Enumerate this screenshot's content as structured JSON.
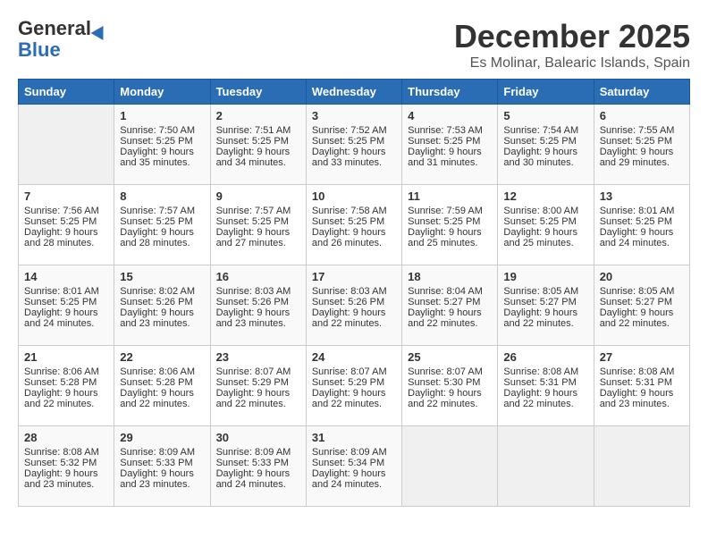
{
  "logo": {
    "general": "General",
    "blue": "Blue"
  },
  "title": {
    "month": "December 2025",
    "location": "Es Molinar, Balearic Islands, Spain"
  },
  "days_header": [
    "Sunday",
    "Monday",
    "Tuesday",
    "Wednesday",
    "Thursday",
    "Friday",
    "Saturday"
  ],
  "weeks": [
    [
      {
        "day": "",
        "info": ""
      },
      {
        "day": "1",
        "sunrise": "Sunrise: 7:50 AM",
        "sunset": "Sunset: 5:25 PM",
        "daylight": "Daylight: 9 hours and 35 minutes."
      },
      {
        "day": "2",
        "sunrise": "Sunrise: 7:51 AM",
        "sunset": "Sunset: 5:25 PM",
        "daylight": "Daylight: 9 hours and 34 minutes."
      },
      {
        "day": "3",
        "sunrise": "Sunrise: 7:52 AM",
        "sunset": "Sunset: 5:25 PM",
        "daylight": "Daylight: 9 hours and 33 minutes."
      },
      {
        "day": "4",
        "sunrise": "Sunrise: 7:53 AM",
        "sunset": "Sunset: 5:25 PM",
        "daylight": "Daylight: 9 hours and 31 minutes."
      },
      {
        "day": "5",
        "sunrise": "Sunrise: 7:54 AM",
        "sunset": "Sunset: 5:25 PM",
        "daylight": "Daylight: 9 hours and 30 minutes."
      },
      {
        "day": "6",
        "sunrise": "Sunrise: 7:55 AM",
        "sunset": "Sunset: 5:25 PM",
        "daylight": "Daylight: 9 hours and 29 minutes."
      }
    ],
    [
      {
        "day": "7",
        "sunrise": "Sunrise: 7:56 AM",
        "sunset": "Sunset: 5:25 PM",
        "daylight": "Daylight: 9 hours and 28 minutes."
      },
      {
        "day": "8",
        "sunrise": "Sunrise: 7:57 AM",
        "sunset": "Sunset: 5:25 PM",
        "daylight": "Daylight: 9 hours and 28 minutes."
      },
      {
        "day": "9",
        "sunrise": "Sunrise: 7:57 AM",
        "sunset": "Sunset: 5:25 PM",
        "daylight": "Daylight: 9 hours and 27 minutes."
      },
      {
        "day": "10",
        "sunrise": "Sunrise: 7:58 AM",
        "sunset": "Sunset: 5:25 PM",
        "daylight": "Daylight: 9 hours and 26 minutes."
      },
      {
        "day": "11",
        "sunrise": "Sunrise: 7:59 AM",
        "sunset": "Sunset: 5:25 PM",
        "daylight": "Daylight: 9 hours and 25 minutes."
      },
      {
        "day": "12",
        "sunrise": "Sunrise: 8:00 AM",
        "sunset": "Sunset: 5:25 PM",
        "daylight": "Daylight: 9 hours and 25 minutes."
      },
      {
        "day": "13",
        "sunrise": "Sunrise: 8:01 AM",
        "sunset": "Sunset: 5:25 PM",
        "daylight": "Daylight: 9 hours and 24 minutes."
      }
    ],
    [
      {
        "day": "14",
        "sunrise": "Sunrise: 8:01 AM",
        "sunset": "Sunset: 5:25 PM",
        "daylight": "Daylight: 9 hours and 24 minutes."
      },
      {
        "day": "15",
        "sunrise": "Sunrise: 8:02 AM",
        "sunset": "Sunset: 5:26 PM",
        "daylight": "Daylight: 9 hours and 23 minutes."
      },
      {
        "day": "16",
        "sunrise": "Sunrise: 8:03 AM",
        "sunset": "Sunset: 5:26 PM",
        "daylight": "Daylight: 9 hours and 23 minutes."
      },
      {
        "day": "17",
        "sunrise": "Sunrise: 8:03 AM",
        "sunset": "Sunset: 5:26 PM",
        "daylight": "Daylight: 9 hours and 22 minutes."
      },
      {
        "day": "18",
        "sunrise": "Sunrise: 8:04 AM",
        "sunset": "Sunset: 5:27 PM",
        "daylight": "Daylight: 9 hours and 22 minutes."
      },
      {
        "day": "19",
        "sunrise": "Sunrise: 8:05 AM",
        "sunset": "Sunset: 5:27 PM",
        "daylight": "Daylight: 9 hours and 22 minutes."
      },
      {
        "day": "20",
        "sunrise": "Sunrise: 8:05 AM",
        "sunset": "Sunset: 5:27 PM",
        "daylight": "Daylight: 9 hours and 22 minutes."
      }
    ],
    [
      {
        "day": "21",
        "sunrise": "Sunrise: 8:06 AM",
        "sunset": "Sunset: 5:28 PM",
        "daylight": "Daylight: 9 hours and 22 minutes."
      },
      {
        "day": "22",
        "sunrise": "Sunrise: 8:06 AM",
        "sunset": "Sunset: 5:28 PM",
        "daylight": "Daylight: 9 hours and 22 minutes."
      },
      {
        "day": "23",
        "sunrise": "Sunrise: 8:07 AM",
        "sunset": "Sunset: 5:29 PM",
        "daylight": "Daylight: 9 hours and 22 minutes."
      },
      {
        "day": "24",
        "sunrise": "Sunrise: 8:07 AM",
        "sunset": "Sunset: 5:29 PM",
        "daylight": "Daylight: 9 hours and 22 minutes."
      },
      {
        "day": "25",
        "sunrise": "Sunrise: 8:07 AM",
        "sunset": "Sunset: 5:30 PM",
        "daylight": "Daylight: 9 hours and 22 minutes."
      },
      {
        "day": "26",
        "sunrise": "Sunrise: 8:08 AM",
        "sunset": "Sunset: 5:31 PM",
        "daylight": "Daylight: 9 hours and 22 minutes."
      },
      {
        "day": "27",
        "sunrise": "Sunrise: 8:08 AM",
        "sunset": "Sunset: 5:31 PM",
        "daylight": "Daylight: 9 hours and 23 minutes."
      }
    ],
    [
      {
        "day": "28",
        "sunrise": "Sunrise: 8:08 AM",
        "sunset": "Sunset: 5:32 PM",
        "daylight": "Daylight: 9 hours and 23 minutes."
      },
      {
        "day": "29",
        "sunrise": "Sunrise: 8:09 AM",
        "sunset": "Sunset: 5:33 PM",
        "daylight": "Daylight: 9 hours and 23 minutes."
      },
      {
        "day": "30",
        "sunrise": "Sunrise: 8:09 AM",
        "sunset": "Sunset: 5:33 PM",
        "daylight": "Daylight: 9 hours and 24 minutes."
      },
      {
        "day": "31",
        "sunrise": "Sunrise: 8:09 AM",
        "sunset": "Sunset: 5:34 PM",
        "daylight": "Daylight: 9 hours and 24 minutes."
      },
      {
        "day": "",
        "info": ""
      },
      {
        "day": "",
        "info": ""
      },
      {
        "day": "",
        "info": ""
      }
    ]
  ]
}
